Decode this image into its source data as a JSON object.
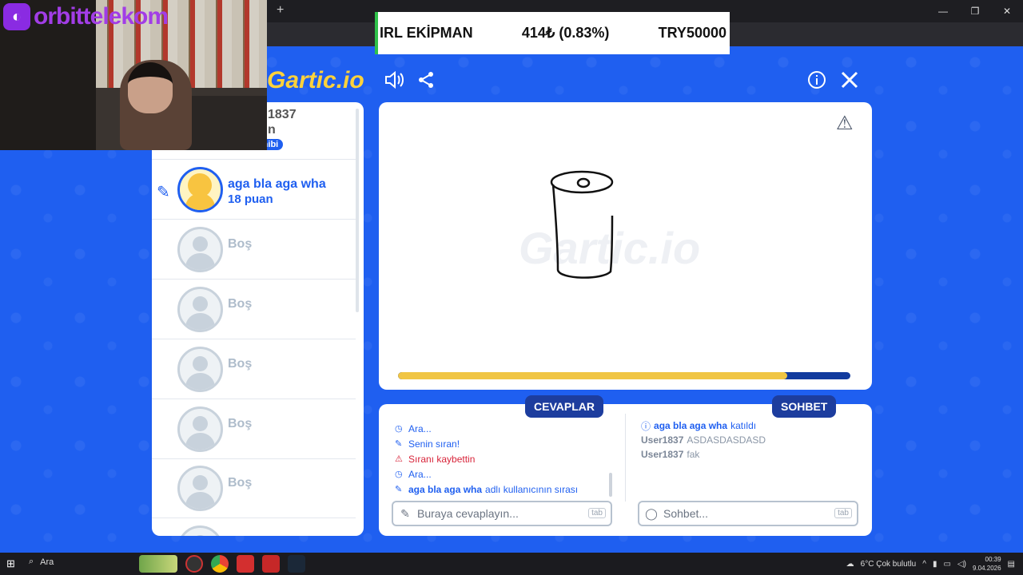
{
  "ticker": {
    "name": "IRL EKİPMAN",
    "price": "414₺ (0.83%)",
    "goal": "TRY50000"
  },
  "overlay": {
    "brand": "orbittelekom"
  },
  "game": {
    "logo": "Gartic.io"
  },
  "players": {
    "partial_name": "1837",
    "partial_sub": "n",
    "owner_badge": "Oda sahibi",
    "active": {
      "name": "aga bla aga wha",
      "score": "18 puan"
    },
    "empty_label": "Boş",
    "slots": [
      "Boş",
      "Boş",
      "Boş",
      "Boş",
      "Boş"
    ]
  },
  "board": {
    "watermark": "Gartic.io",
    "progress_fraction": 0.86
  },
  "answers": {
    "tab_label": "CEVAPLAR",
    "placeholder": "Buraya cevaplayın...",
    "tab_key": "tab",
    "lines": [
      {
        "icon": "clock-icon",
        "text": "Ara...",
        "style": "blue"
      },
      {
        "icon": "pencil-icon",
        "text": "Senin sıran!",
        "style": "blue"
      },
      {
        "icon": "warning-icon",
        "text": "Sıranı kaybettin",
        "style": "red"
      },
      {
        "icon": "clock-icon",
        "text": "Ara...",
        "style": "blue"
      },
      {
        "icon": "pencil-icon",
        "bold": "aga bla aga wha",
        "text": "adlı kullanıcının sırası",
        "style": "blue"
      }
    ]
  },
  "chat": {
    "tab_label": "SOHBET",
    "placeholder": "Sohbet...",
    "tab_key": "tab",
    "lines": [
      {
        "system": true,
        "user": "aga bla aga wha",
        "text": "katıldı"
      },
      {
        "system": false,
        "user": "User1837",
        "text": "ASDASDASDASD"
      },
      {
        "system": false,
        "user": "User1837",
        "text": "fak"
      }
    ]
  },
  "taskbar": {
    "search": "Ara",
    "weather": "6°C  Çok bulutlu",
    "time": "00:39",
    "date": "9.04.2026"
  }
}
